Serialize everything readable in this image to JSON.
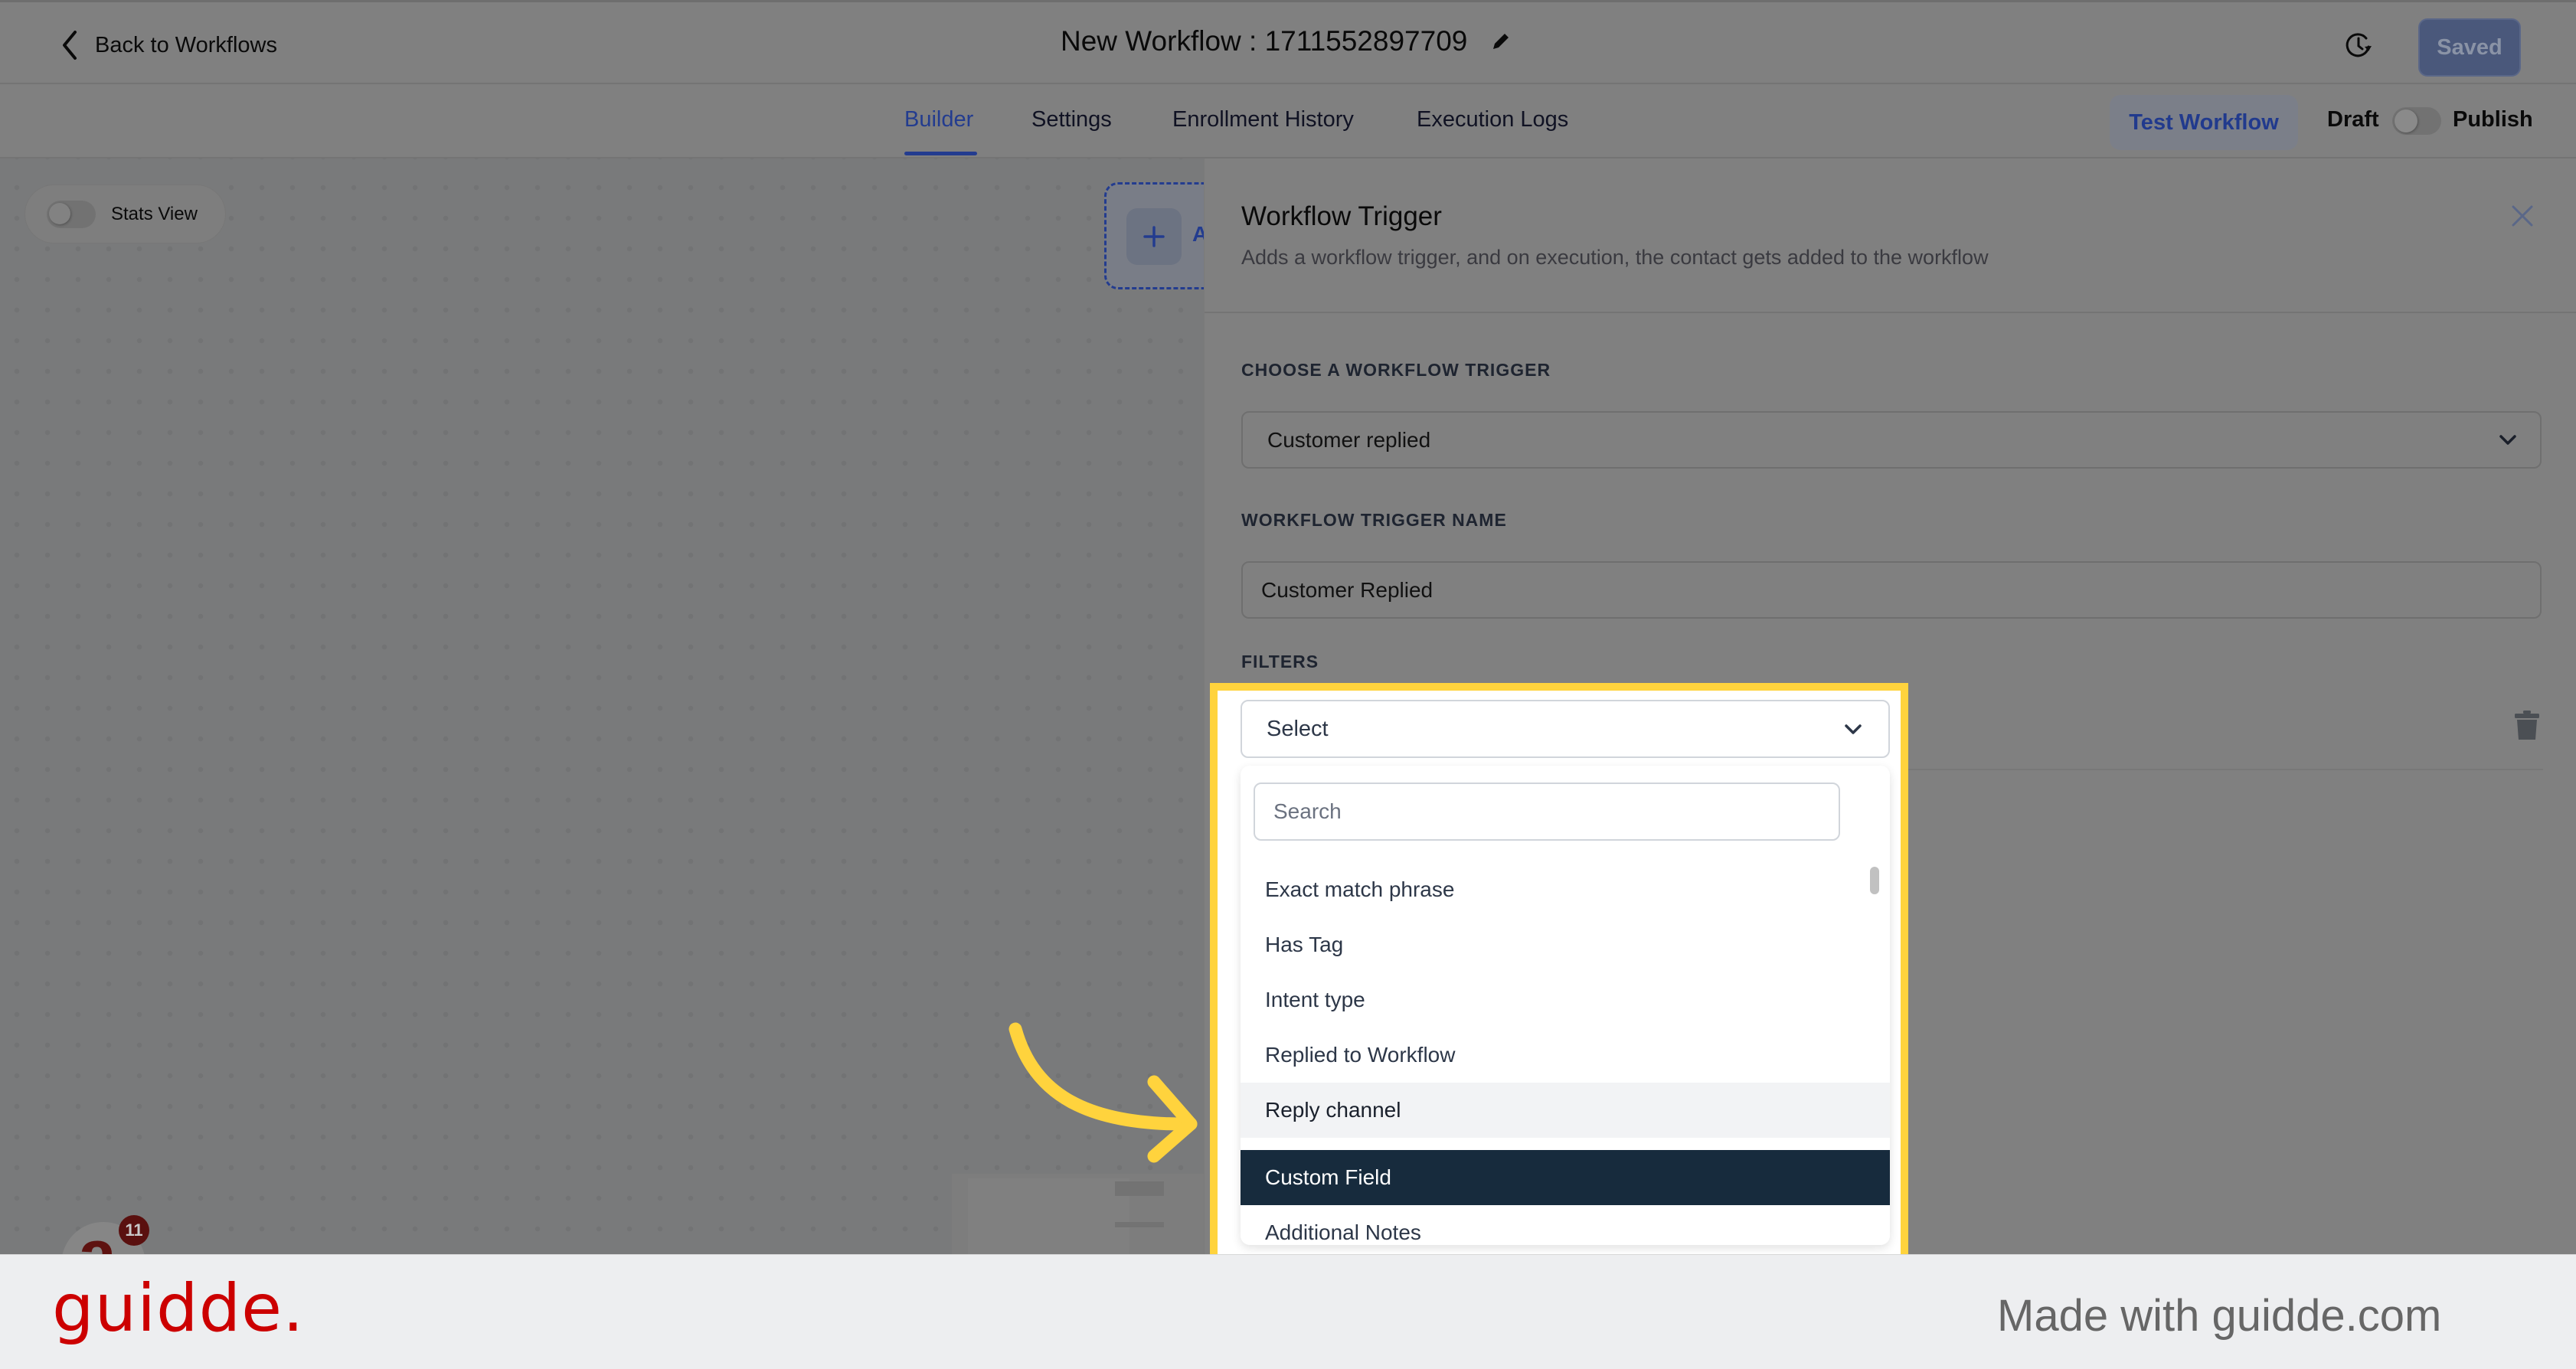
{
  "header": {
    "back_label": "Back to Workflows",
    "workflow_title": "New Workflow : 1711552897709",
    "saved_label": "Saved"
  },
  "tabs": [
    {
      "label": "Builder",
      "active": true
    },
    {
      "label": "Settings",
      "active": false
    },
    {
      "label": "Enrollment History",
      "active": false
    },
    {
      "label": "Execution Logs",
      "active": false
    }
  ],
  "actions": {
    "test_workflow_label": "Test Workflow",
    "draft_label": "Draft",
    "publish_label": "Publish",
    "publish_toggle_on": false
  },
  "canvas": {
    "stats_view_label": "Stats View",
    "stats_view_on": false,
    "add_trigger_label": "A",
    "avatar_letter": "a",
    "avatar_badge_count": "11"
  },
  "panel": {
    "title": "Workflow Trigger",
    "subtitle": "Adds a workflow trigger, and on execution, the contact gets added to the workflow",
    "trigger_label": "CHOOSE A WORKFLOW TRIGGER",
    "trigger_value": "Customer replied",
    "name_label": "WORKFLOW TRIGGER NAME",
    "name_value": "Customer Replied",
    "filters_label": "FILTERS"
  },
  "filter_dropdown": {
    "selected_placeholder": "Select",
    "search_placeholder": "Search",
    "options": [
      {
        "label": "Exact match phrase",
        "state": "normal"
      },
      {
        "label": "Has Tag",
        "state": "normal"
      },
      {
        "label": "Intent type",
        "state": "normal"
      },
      {
        "label": "Replied to Workflow",
        "state": "normal"
      },
      {
        "label": "Reply channel",
        "state": "hover"
      },
      {
        "label": "Custom Field",
        "state": "selected"
      },
      {
        "label": "Additional Notes",
        "state": "normal"
      }
    ]
  },
  "colors": {
    "accent": "#233c8f",
    "highlight": "#ffd33d",
    "selected_option_bg": "#172b3d",
    "brand_red": "#cc0000"
  },
  "footer": {
    "brand": "guidde.",
    "made_with": "Made with guidde.com"
  }
}
